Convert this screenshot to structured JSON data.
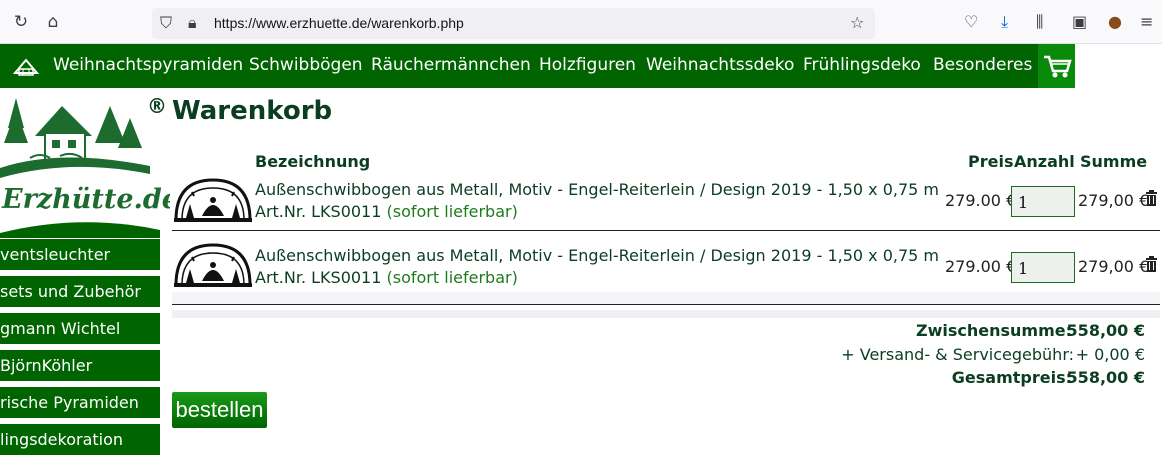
{
  "browser": {
    "url": "https://www.erzhuette.de/warenkorb.php"
  },
  "nav": {
    "items": [
      "Weihnachtspyramiden",
      "Schwibbögen",
      "Räuchermännchen",
      "Holzfiguren",
      "Weihnachtssdeko",
      "Frühlingsdeko",
      "Besonderes"
    ]
  },
  "logo": {
    "text": "Erzhütte.de",
    "registered": "®"
  },
  "sidebar": {
    "items": [
      "ventsleuchter",
      "sets und Zubehör",
      "gmann Wichtel",
      "BjörnKöhler",
      "rische Pyramiden",
      "lingsdekoration"
    ]
  },
  "page": {
    "title": "Warenkorb"
  },
  "table": {
    "headers": {
      "name": "Bezeichnung",
      "price": "Preis",
      "qty": "Anzahl",
      "sum": "Summe"
    },
    "rows": [
      {
        "name": "Außenschwibbogen aus Metall, Motiv - Engel-Reiterlein / Design 2019 - 1,50 x 0,75 m",
        "art": "Art.Nr. LKS0011",
        "availability": "(sofort lieferbar)",
        "price": "279.00 €",
        "qty": "1",
        "sum": "279,00 €"
      },
      {
        "name": "Außenschwibbogen aus Metall, Motiv - Engel-Reiterlein / Design 2019 - 1,50 x 0,75 m",
        "art": "Art.Nr. LKS0011",
        "availability": "(sofort lieferbar)",
        "price": "279.00 €",
        "qty": "1",
        "sum": "279,00 €"
      }
    ]
  },
  "totals": {
    "subtotal_label": "Zwischensumme:",
    "subtotal_value": "558,00 €",
    "shipping_label": "+ Versand- & Servicegebühr:",
    "shipping_value": "+ 0,00 €",
    "total_label": "Gesamtpreis:",
    "total_value": "558,00 €"
  },
  "actions": {
    "order_label": "bestellen"
  },
  "colors": {
    "brand_green": "#006400",
    "text_green": "#0b3d22",
    "availability_green": "#1f7a1f"
  }
}
